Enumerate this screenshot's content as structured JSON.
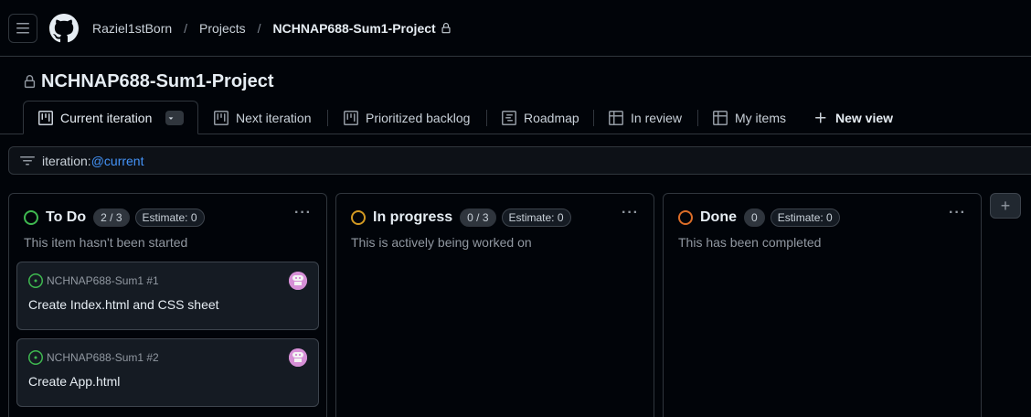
{
  "header": {
    "breadcrumbs": [
      {
        "label": "Raziel1stBorn"
      },
      {
        "label": "Projects"
      },
      {
        "label": "NCHNAP688-Sum1-Project"
      }
    ],
    "separator": "/"
  },
  "project": {
    "title": "NCHNAP688-Sum1-Project"
  },
  "tabs": [
    {
      "label": "Current iteration",
      "icon": "board-icon",
      "active": true
    },
    {
      "label": "Next iteration",
      "icon": "board-icon"
    },
    {
      "label": "Prioritized backlog",
      "icon": "board-icon"
    },
    {
      "label": "Roadmap",
      "icon": "roadmap-icon"
    },
    {
      "label": "In review",
      "icon": "table-icon"
    },
    {
      "label": "My items",
      "icon": "table-icon"
    },
    {
      "label": "New view",
      "icon": "plus-icon"
    }
  ],
  "filter": {
    "key": "iteration:",
    "value": "@current"
  },
  "columns": [
    {
      "name": "To Do",
      "count": "2 / 3",
      "estimate": "Estimate: 0",
      "description": "This item hasn't been started",
      "color": "#3fb950",
      "cards": [
        {
          "repo": "NCHNAP688-Sum1 #1",
          "title": "Create Index.html and CSS sheet"
        },
        {
          "repo": "NCHNAP688-Sum1 #2",
          "title": "Create App.html"
        }
      ]
    },
    {
      "name": "In progress",
      "count": "0 / 3",
      "estimate": "Estimate: 0",
      "description": "This is actively being worked on",
      "color": "#d29922",
      "cards": []
    },
    {
      "name": "Done",
      "count": "0",
      "estimate": "Estimate: 0",
      "description": "This has been completed",
      "color": "#db6d28",
      "cards": []
    }
  ],
  "more_label": "···",
  "add_column_label": "+",
  "colors": {
    "accent": "#4493f8",
    "open_issue": "#3fb950",
    "border": "#30363d"
  }
}
